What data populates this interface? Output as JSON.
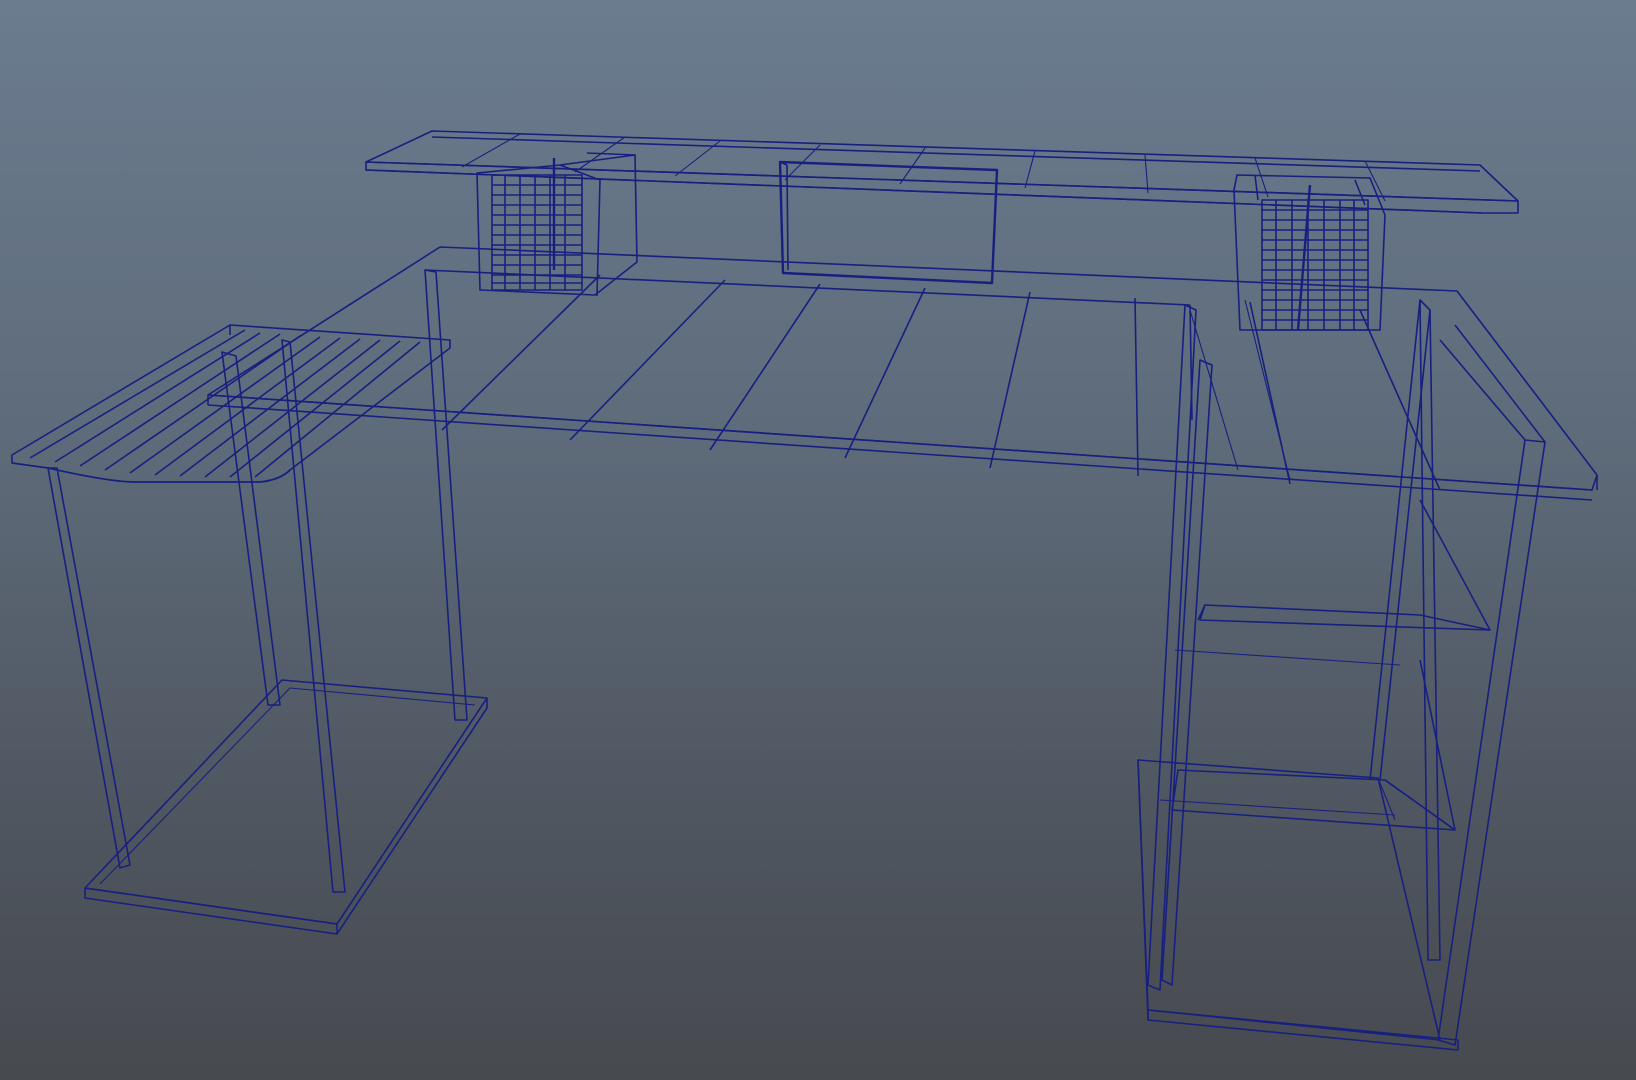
{
  "viewport": {
    "background_top": "#6b7c8f",
    "background_bottom": "#474a4f",
    "wire_color": "#18207f"
  },
  "scene": {
    "object": "desk-wireframe"
  }
}
